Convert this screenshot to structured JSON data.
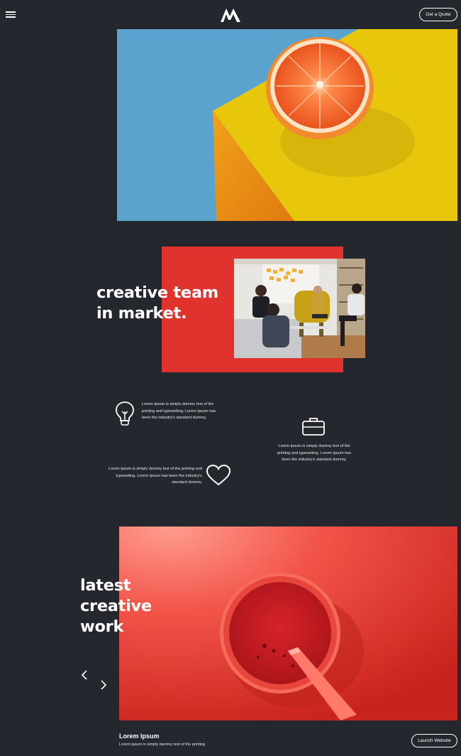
{
  "header": {
    "quote_label": "Get a Quote"
  },
  "about": {
    "title_line1": "creative team",
    "title_line2": "in market."
  },
  "features": [
    {
      "icon": "lightbulb-icon",
      "text": "Lorem ipsum is simply dummy text of the printing and typesetting. Lorem Ipsum has been the industry's standard dummy."
    },
    {
      "icon": "briefcase-icon",
      "text": "Lorem ipsum is simply dummy text of the printing and typesetting. Lorem Ipsum has been the industry's standard dummy."
    },
    {
      "icon": "heart-icon",
      "text": "Lorem ipsum is simply dummy text of the printing and typesetting. Lorem Ipsum has been the industry's standard dummy."
    }
  ],
  "work": {
    "title_line1": "latest",
    "title_line2": "creative",
    "title_line3": "work",
    "item_name": "Lorem Ipsum",
    "item_desc": "Lorem ipsum is simply dummy text of the printing",
    "launch_label": "Launch Website"
  },
  "colors": {
    "background": "#24272e",
    "accent_red": "#e0332e",
    "hero_blue": "#5ba3cf",
    "hero_yellow": "#e8c60c"
  }
}
